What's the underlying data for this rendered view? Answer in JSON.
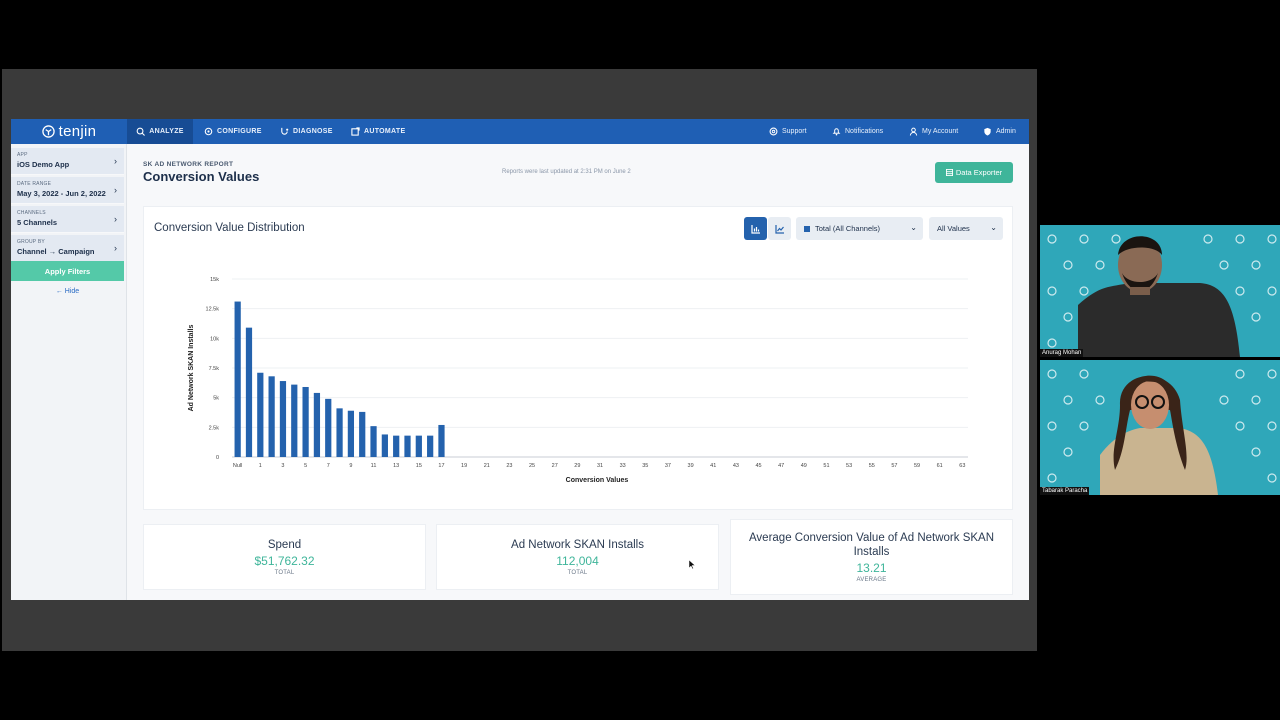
{
  "app": {
    "logo_text": "tenjin",
    "nav": {
      "analyze": "ANALYZE",
      "configure": "CONFIGURE",
      "diagnose": "DIAGNOSE",
      "automate": "AUTOMATE",
      "support": "Support",
      "notifications": "Notifications",
      "my_account": "My Account",
      "admin": "Admin"
    },
    "sidebar": {
      "filters": [
        {
          "label": "APP",
          "value": "iOS Demo App"
        },
        {
          "label": "DATE RANGE",
          "value": "May 3, 2022 - Jun 2, 2022"
        },
        {
          "label": "CHANNELS",
          "value": "5 Channels"
        },
        {
          "label": "GROUP BY",
          "value": "Channel → Campaign"
        }
      ],
      "apply_label": "Apply Filters",
      "hide_label": "← Hide"
    },
    "header": {
      "subtitle": "SK AD NETWORK REPORT",
      "title": "Conversion Values",
      "updated": "Reports were last updated at 2:31 PM on June 2",
      "exporter_label": "Data Exporter"
    },
    "chart_card": {
      "title": "Conversion Value Distribution",
      "channel_select": "Total (All Channels)",
      "values_select": "All Values"
    },
    "stats": [
      {
        "title": "Spend",
        "value": "$51,762.32",
        "sub": "TOTAL"
      },
      {
        "title": "Ad Network SKAN Installs",
        "value": "112,004",
        "sub": "TOTAL"
      },
      {
        "title": "Average Conversion Value of Ad Network SKAN Installs",
        "value": "13.21",
        "sub": "AVERAGE"
      }
    ],
    "colors": {
      "nav": "#1f5fb4",
      "accent": "#3fb59a",
      "bar": "#2462ad"
    }
  },
  "video": {
    "participants": [
      "Anurag Mohan",
      "Tabarak Paracha"
    ]
  },
  "chart_data": {
    "type": "bar",
    "xlabel": "Conversion Values",
    "ylabel": "Ad Network SKAN Installs",
    "ylim": [
      0,
      15000
    ],
    "y_ticks": [
      "0",
      "2.5k",
      "5k",
      "7.5k",
      "10k",
      "12.5k",
      "15k"
    ],
    "categories": [
      "Null",
      "0",
      "1",
      "2",
      "3",
      "4",
      "5",
      "6",
      "7",
      "8",
      "9",
      "10",
      "11",
      "12",
      "13",
      "14",
      "15",
      "16",
      "17",
      "18",
      "19",
      "20",
      "21",
      "22",
      "23",
      "24",
      "25",
      "26",
      "27",
      "28",
      "29",
      "30",
      "31",
      "32",
      "33",
      "34",
      "35",
      "36",
      "37",
      "38",
      "39",
      "40",
      "41",
      "42",
      "43",
      "44",
      "45",
      "46",
      "47",
      "48",
      "49",
      "50",
      "51",
      "52",
      "53",
      "54",
      "55",
      "56",
      "57",
      "58",
      "59",
      "60",
      "61",
      "62",
      "63"
    ],
    "x_tick_labels": [
      "Null",
      "1",
      "3",
      "5",
      "7",
      "9",
      "11",
      "13",
      "15",
      "17",
      "19",
      "21",
      "23",
      "25",
      "27",
      "29",
      "31",
      "33",
      "35",
      "37",
      "39",
      "41",
      "43",
      "45",
      "47",
      "49",
      "51",
      "53",
      "55",
      "57",
      "59",
      "61",
      "63"
    ],
    "values": [
      13100,
      10900,
      7100,
      6800,
      6400,
      6100,
      5900,
      5400,
      4900,
      4100,
      3900,
      3800,
      2600,
      1900,
      1800,
      1800,
      1800,
      1800,
      2700,
      0,
      0,
      0,
      0,
      0,
      0,
      0,
      0,
      0,
      0,
      0,
      0,
      0,
      0,
      0,
      0,
      0,
      0,
      0,
      0,
      0,
      0,
      0,
      0,
      0,
      0,
      0,
      0,
      0,
      0,
      0,
      0,
      0,
      0,
      0,
      0,
      0,
      0,
      0,
      0,
      0,
      0,
      0,
      0,
      0,
      0
    ],
    "grid": true,
    "legend": "none"
  }
}
